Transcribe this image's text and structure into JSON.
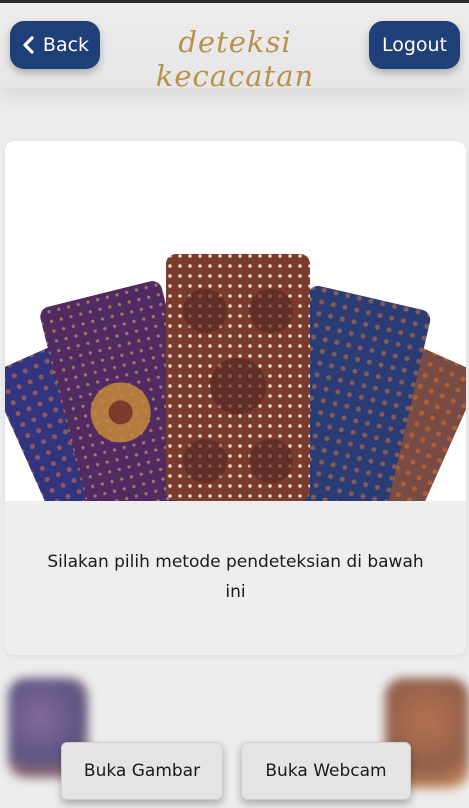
{
  "header": {
    "back_label": "Back",
    "title": "deteksi kecacatan",
    "logout_label": "Logout"
  },
  "main": {
    "instruction": "Silakan pilih metode pendeteksian di bawah ini"
  },
  "actions": {
    "open_image_label": "Buka Gambar",
    "open_webcam_label": "Buka Webcam"
  },
  "colors": {
    "primary": "#1f3f78",
    "title_gold": "#b8924a",
    "background": "#ececec"
  },
  "icons": {
    "back": "chevron-left-icon"
  }
}
